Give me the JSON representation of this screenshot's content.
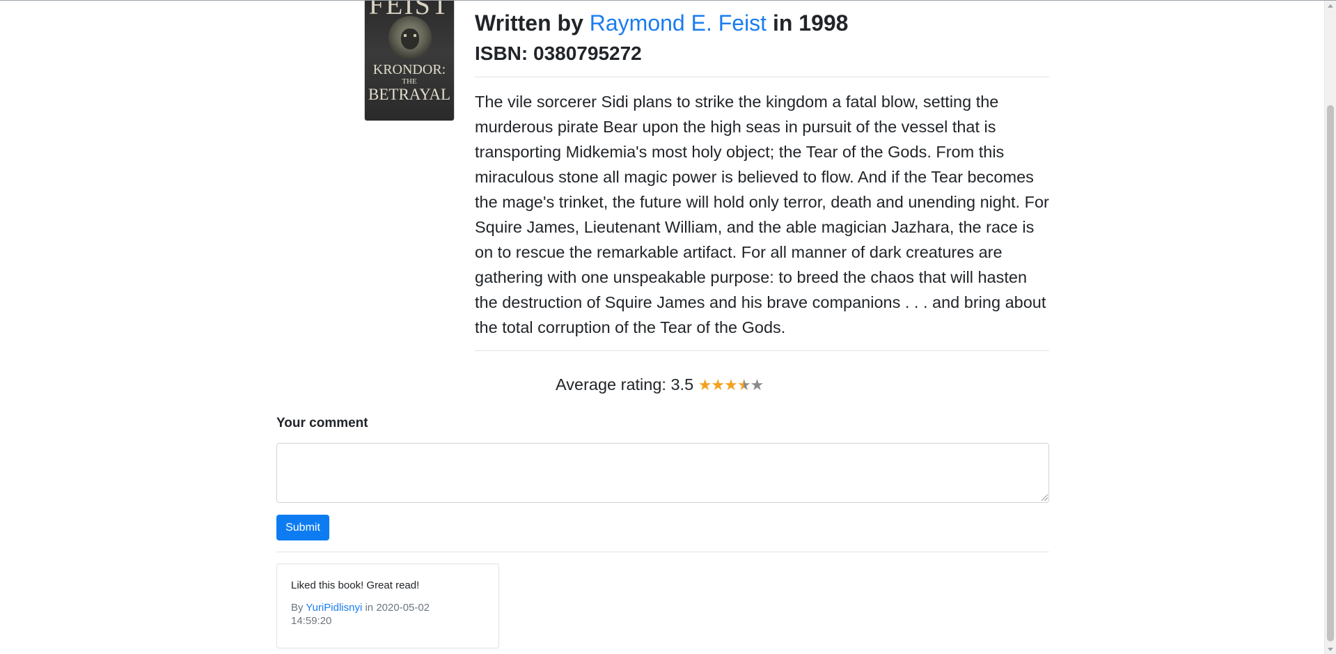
{
  "book": {
    "cover": {
      "author_text": "FEIST",
      "title_line1": "KRONDOR:",
      "title_line2": "THE",
      "title_line3": "BETRAYAL"
    },
    "written_by_prefix": "Written by",
    "author": "Raymond E. Feist",
    "year_prefix": "in",
    "year": "1998",
    "isbn_label": "ISBN:",
    "isbn": "0380795272",
    "description": "The vile sorcerer Sidi plans to strike the kingdom a fatal blow, setting the murderous pirate Bear upon the high seas in pursuit of the vessel that is transporting Midkemia's most holy object; the Tear of the Gods. From this miraculous stone all magic power is believed to flow. And if the Tear becomes the mage's trinket, the future will hold only terror, death and unending night. For Squire James, Lieutenant William, and the able magician Jazhara, the race is on to rescue the remarkable artifact. For all manner of dark creatures are gathering with one unspeakable purpose: to breed the chaos that will hasten the destruction of Squire James and his brave companions . . . and bring about the total corruption of the Tear of the Gods."
  },
  "rating": {
    "label": "Average rating:",
    "value": "3.5",
    "stars_filled": 3,
    "stars_half": 1,
    "stars_total": 5,
    "star_color": "#f4a11d",
    "empty_star_color": "#8a8a8a"
  },
  "comment_form": {
    "label": "Your comment",
    "value": "",
    "submit_label": "Submit"
  },
  "comments": [
    {
      "text": "Liked this book! Great read!",
      "by_label": "By",
      "user": "YuriPidlisnyi",
      "in_label": "in",
      "date": "2020-05-02",
      "time": "14:59:20"
    }
  ],
  "colors": {
    "link": "#1a7cf0",
    "primary_button": "#0d7cf2"
  }
}
